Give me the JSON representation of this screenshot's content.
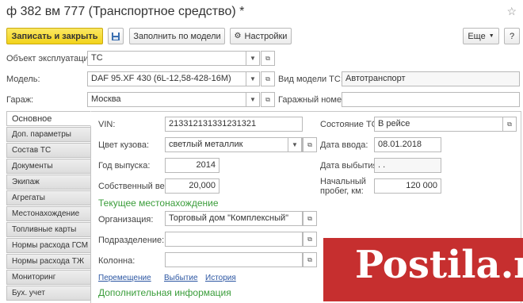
{
  "window": {
    "title": "ф 382 вм 777  (Транспортное средство)",
    "modified_mark": "*"
  },
  "toolbar": {
    "save_close": "Записать и закрыть",
    "fill_by_model": "Заполнить по модели",
    "settings": "Настройки",
    "more": "Еще",
    "help": "?"
  },
  "header_fields": {
    "object_label": "Объект эксплуатации:",
    "object_value": "ТС",
    "model_label": "Модель:",
    "model_value": "DAF 95.XF 430 (6L-12,58-428-16M)",
    "model_kind_label": "Вид модели ТС:",
    "model_kind_value": "Автотранспорт",
    "garage_label": "Гараж:",
    "garage_value": "Москва",
    "garage_number_label": "Гаражный номер:",
    "garage_number_value": ""
  },
  "tabs": [
    "Основное",
    "Доп. параметры",
    "Состав ТС",
    "Документы",
    "Экипаж",
    "Агрегаты",
    "Местонахождение",
    "Топливные карты",
    "Нормы расхода ГСМ",
    "Нормы расхода ТЖ",
    "Мониторинг",
    "Бух. учет"
  ],
  "main": {
    "vin_label": "VIN:",
    "vin_value": "21331213133123132​1",
    "color_label": "Цвет кузова:",
    "color_value": "светлый металлик",
    "year_label": "Год выпуска:",
    "year_value": "2014",
    "weight_label": "Собственный вес:",
    "weight_value": "20,000",
    "state_label": "Состояние ТС:",
    "state_value": "В рейсе",
    "entry_date_label": "Дата ввода:",
    "entry_date_value": "08.01.2018",
    "exit_date_label": "Дата выбытия:",
    "exit_date_value": " .  .",
    "mileage_label_1": "Начальный",
    "mileage_label_2": "пробег, км:",
    "mileage_value": "120 000",
    "location_section": "Текущее местонахождение",
    "org_label": "Организация:",
    "org_value": "Торговый дом \"Комплексный\"",
    "division_label": "Подразделение:",
    "division_value": "",
    "column_label": "Колонна:",
    "column_value": "",
    "link_move": "Перемещение",
    "link_exit": "Выбытие",
    "link_history": "История",
    "additional_section": "Дополнительная информация"
  },
  "watermark": {
    "text": "Postila.ru"
  },
  "colors": {
    "primary_button": "#f2d31a",
    "section": "#3a9d3a",
    "link": "#2d57a3",
    "watermark": "#c62f2f"
  }
}
